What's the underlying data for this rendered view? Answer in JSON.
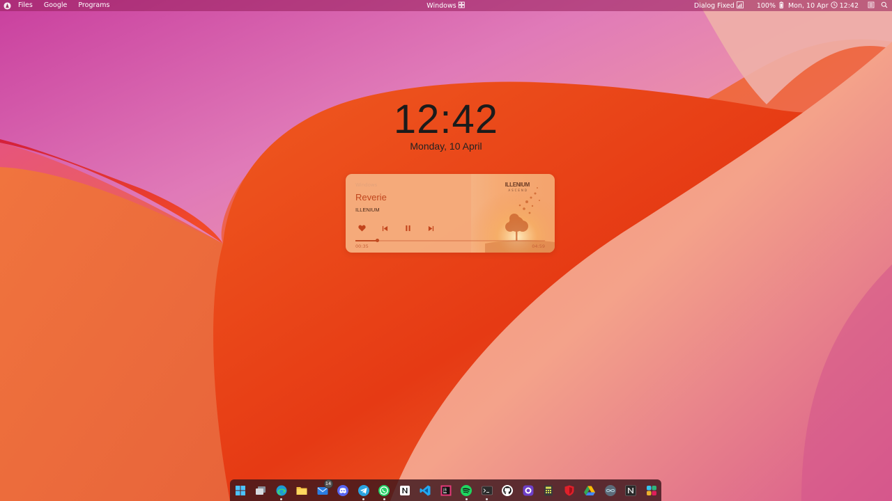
{
  "topbar": {
    "menu": [
      "Files",
      "Google",
      "Programs"
    ],
    "center_label": "Windows",
    "display_mode": "Dialog Fixed",
    "battery": "100%",
    "datetime": "Mon, 10 Apr",
    "time": "12:42"
  },
  "clock": {
    "time": "12:42",
    "date": "Monday, 10 April"
  },
  "media": {
    "source": "Windows",
    "title": "Reverie",
    "artist": "ILLENIUM",
    "brand": "ILLENIUM",
    "brand_sub": "ASCEND",
    "elapsed": "00:35",
    "total": "04:59",
    "progress": 0.117
  },
  "dock": {
    "apps": [
      {
        "name": "start-menu",
        "icon": "windows-logo-icon"
      },
      {
        "name": "task-view",
        "icon": "task-view-icon"
      },
      {
        "name": "edge",
        "icon": "edge-icon",
        "running": true
      },
      {
        "name": "file-explorer",
        "icon": "folder-icon"
      },
      {
        "name": "mail",
        "icon": "mail-icon",
        "badge": "14"
      },
      {
        "name": "discord",
        "icon": "discord-icon"
      },
      {
        "name": "telegram",
        "icon": "telegram-icon",
        "running": true
      },
      {
        "name": "whatsapp",
        "icon": "whatsapp-icon",
        "running": true
      },
      {
        "name": "notion",
        "icon": "notion-icon"
      },
      {
        "name": "vscode",
        "icon": "vscode-icon"
      },
      {
        "name": "jetbrains",
        "icon": "jetbrains-icon"
      },
      {
        "name": "spotify",
        "icon": "spotify-icon",
        "running": true
      },
      {
        "name": "terminal",
        "icon": "terminal-icon",
        "running": true
      },
      {
        "name": "github",
        "icon": "github-icon"
      },
      {
        "name": "github-desktop",
        "icon": "github-desktop-icon"
      },
      {
        "name": "calculator",
        "icon": "calculator-icon"
      },
      {
        "name": "security",
        "icon": "shield-icon"
      },
      {
        "name": "google-drive",
        "icon": "drive-icon"
      },
      {
        "name": "arduino",
        "icon": "arduino-icon"
      },
      {
        "name": "notion-dark",
        "icon": "notion-n-icon"
      },
      {
        "name": "slack",
        "icon": "slack-icon"
      }
    ]
  },
  "colors": {
    "accent": "#c0451d",
    "card": "#f5b282",
    "dock": "#3c161c"
  }
}
